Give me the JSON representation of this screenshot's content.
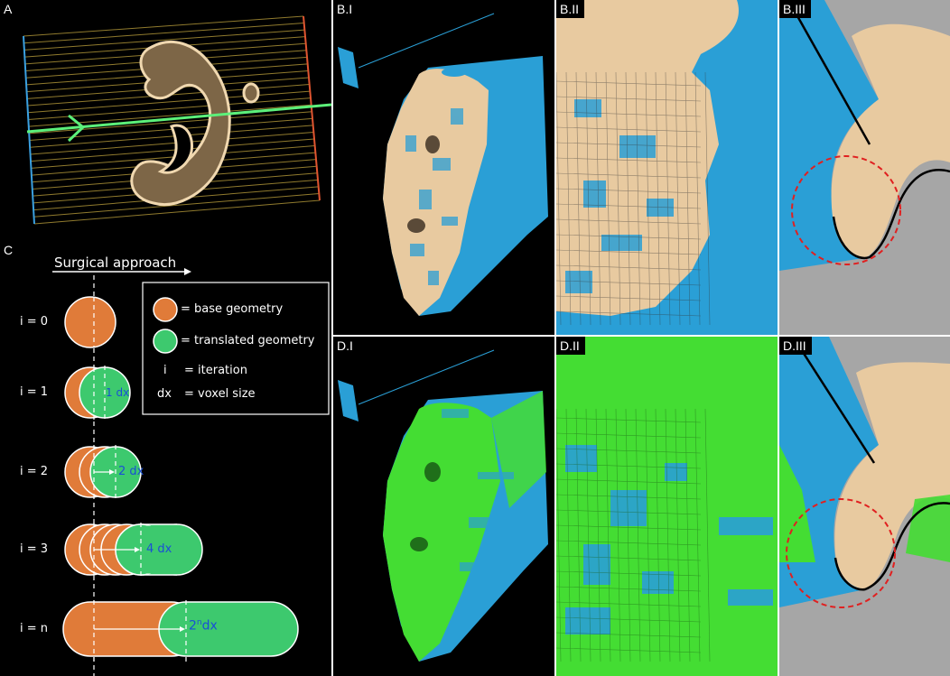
{
  "panels": {
    "A": "A",
    "C": "C",
    "BI": "B.I",
    "BII": "B.II",
    "BIII": "B.III",
    "DI": "D.I",
    "DII": "D.II",
    "DIII": "D.III"
  },
  "panel_c": {
    "arrow_label": "Surgical approach",
    "rows": [
      {
        "label": "i = 0",
        "shift": ""
      },
      {
        "label": "i = 1",
        "shift": "1 dx"
      },
      {
        "label": "i = 2",
        "shift": "2 dx"
      },
      {
        "label": "i = 3",
        "shift": "4 dx"
      },
      {
        "label": "i = n",
        "shift_base": "2",
        "shift_exp": "n",
        "shift_unit": "dx"
      }
    ],
    "legend": {
      "base": "= base geometry",
      "translated": "= translated geometry",
      "i_sym": "i",
      "i_desc": "= iteration",
      "dx_sym": "dx",
      "dx_desc": "= voxel size"
    }
  },
  "colors": {
    "base": "#e07b39",
    "translated": "#3dc96e",
    "voxel_blue": "#2a9fd6",
    "bone": "#e8caa0",
    "highlight_green": "#44dd33",
    "circle_red": "#e02020",
    "shift_text": "#1a4fd6"
  }
}
